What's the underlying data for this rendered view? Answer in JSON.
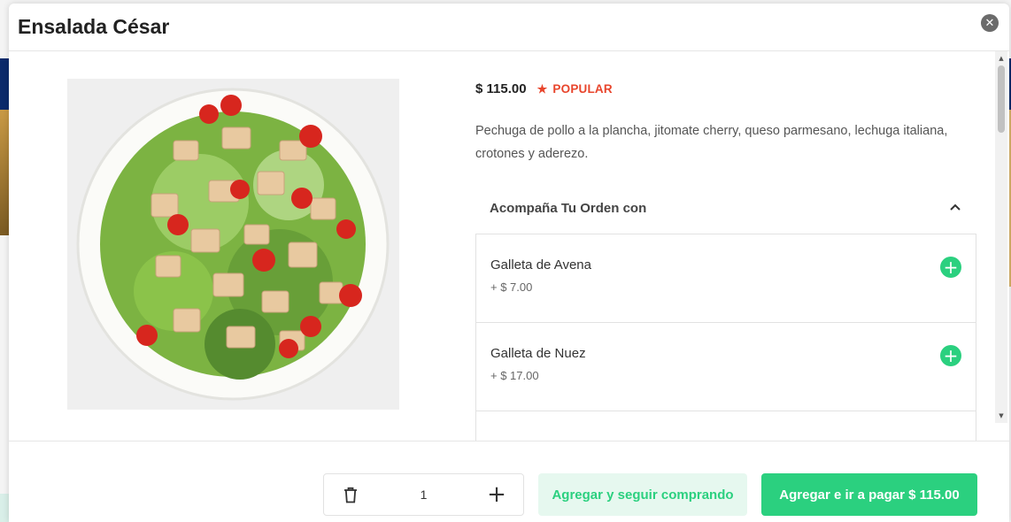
{
  "modal": {
    "title": "Ensalada César",
    "close_icon": "close-icon"
  },
  "product": {
    "price": "$ 115.00",
    "popular_label": "POPULAR",
    "popular_icon": "star-icon",
    "description": "Pechuga de pollo a la plancha, jitomate cherry, queso parmesano, lechuga italiana, crotones y aderezo."
  },
  "accordion": {
    "title": "Acompaña Tu Orden con",
    "chevron_icon": "chevron-up-icon"
  },
  "options": [
    {
      "name": "Galleta de Avena",
      "price": "+ $ 7.00"
    },
    {
      "name": "Galleta de Nuez",
      "price": "+ $ 17.00"
    }
  ],
  "footer": {
    "quantity": "1",
    "continue_label": "Agregar y seguir comprando",
    "pay_label": "Agregar e ir a pagar $ 115.00"
  },
  "colors": {
    "accent_green": "#2bd07f",
    "popular_red": "#e8452c",
    "background_navy": "#0b2a6b"
  }
}
